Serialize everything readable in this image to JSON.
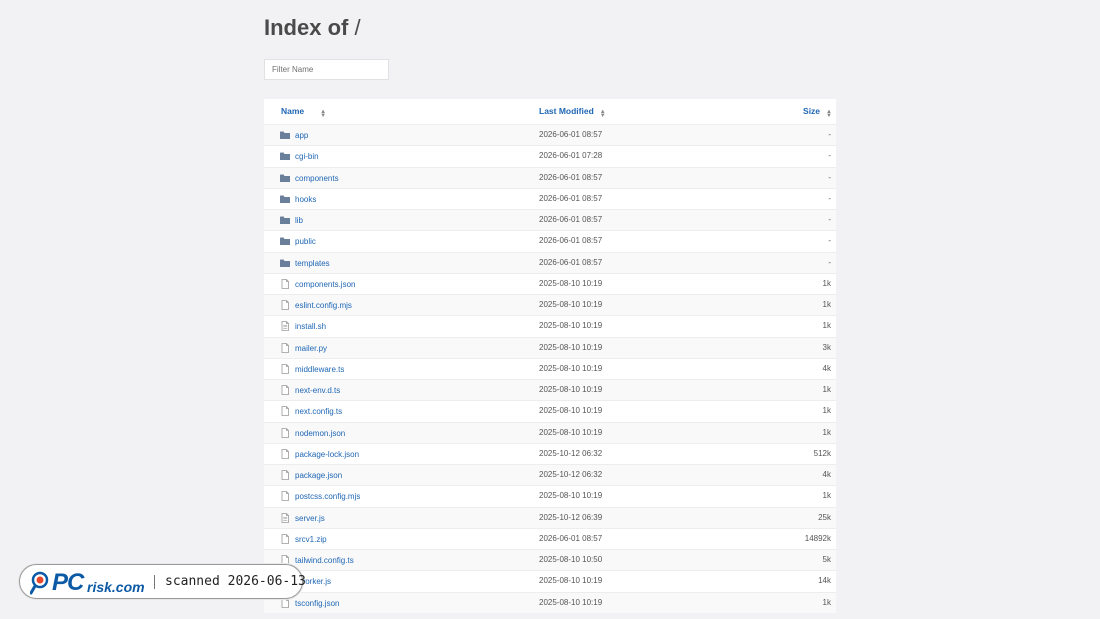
{
  "page": {
    "title": "Index of",
    "path": "/"
  },
  "filter": {
    "placeholder": "Filter Name",
    "value": ""
  },
  "table": {
    "columns": {
      "name": "Name",
      "modified": "Last Modified",
      "size": "Size"
    },
    "rows": [
      {
        "name": "app",
        "type": "folder",
        "modified": "2026-06-01 08:57",
        "size": "-"
      },
      {
        "name": "cgi-bin",
        "type": "folder",
        "modified": "2026-06-01 07:28",
        "size": "-"
      },
      {
        "name": "components",
        "type": "folder",
        "modified": "2026-06-01 08:57",
        "size": "-"
      },
      {
        "name": "hooks",
        "type": "folder",
        "modified": "2026-06-01 08:57",
        "size": "-"
      },
      {
        "name": "lib",
        "type": "folder",
        "modified": "2026-06-01 08:57",
        "size": "-"
      },
      {
        "name": "public",
        "type": "folder",
        "modified": "2026-06-01 08:57",
        "size": "-"
      },
      {
        "name": "templates",
        "type": "folder",
        "modified": "2026-06-01 08:57",
        "size": "-"
      },
      {
        "name": "components.json",
        "type": "file",
        "modified": "2025-08-10 10:19",
        "size": "1k"
      },
      {
        "name": "eslint.config.mjs",
        "type": "file",
        "modified": "2025-08-10 10:19",
        "size": "1k"
      },
      {
        "name": "install.sh",
        "type": "text",
        "modified": "2025-08-10 10:19",
        "size": "1k"
      },
      {
        "name": "mailer.py",
        "type": "file",
        "modified": "2025-08-10 10:19",
        "size": "3k"
      },
      {
        "name": "middleware.ts",
        "type": "file",
        "modified": "2025-08-10 10:19",
        "size": "4k"
      },
      {
        "name": "next-env.d.ts",
        "type": "file",
        "modified": "2025-08-10 10:19",
        "size": "1k"
      },
      {
        "name": "next.config.ts",
        "type": "file",
        "modified": "2025-08-10 10:19",
        "size": "1k"
      },
      {
        "name": "nodemon.json",
        "type": "file",
        "modified": "2025-08-10 10:19",
        "size": "1k"
      },
      {
        "name": "package-lock.json",
        "type": "file",
        "modified": "2025-10-12 06:32",
        "size": "512k"
      },
      {
        "name": "package.json",
        "type": "file",
        "modified": "2025-10-12 06:32",
        "size": "4k"
      },
      {
        "name": "postcss.config.mjs",
        "type": "file",
        "modified": "2025-08-10 10:19",
        "size": "1k"
      },
      {
        "name": "server.js",
        "type": "text",
        "modified": "2025-10-12 06:39",
        "size": "25k"
      },
      {
        "name": "srcv1.zip",
        "type": "file",
        "modified": "2026-06-01 08:57",
        "size": "14892k"
      },
      {
        "name": "tailwind.config.ts",
        "type": "file",
        "modified": "2025-08-10 10:50",
        "size": "5k"
      },
      {
        "name": "eworker.js",
        "type": "file",
        "modified": "2025-08-10 10:19",
        "size": "14k"
      },
      {
        "name": "tsconfig.json",
        "type": "file",
        "modified": "2025-08-10 10:19",
        "size": "1k"
      }
    ]
  },
  "watermark": {
    "logo_pc": "PC",
    "logo_risk": "risk.com",
    "text": "scanned 2026-06-13"
  },
  "colors": {
    "link": "#1e66b4",
    "folder_icon": "#6a7f99",
    "file_icon": "#9a9a9a",
    "logo": "#0c5aa6"
  }
}
